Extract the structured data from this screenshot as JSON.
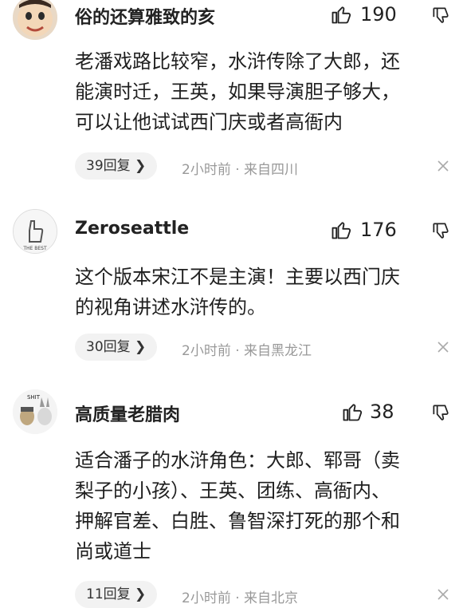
{
  "comments": [
    {
      "username": "俗的还算雅致的亥",
      "likes": "190",
      "lines": [
        "老潘戏路比较窄，水浒传除了大郎，还",
        "能演时迁，王英，如果导演胆子够大，",
        "可以让他试试西门庆或者高衙内"
      ],
      "replies": "39回复",
      "meta": "2小时前 · 来自四川"
    },
    {
      "username": "Zeroseattle",
      "likes": "176",
      "avatar_text": "THE BEST",
      "lines": [
        "这个版本宋江不是主演！主要以西门庆",
        "的视角讲述水浒传的。"
      ],
      "replies": "30回复",
      "meta": "2小时前 · 来自黑龙江"
    },
    {
      "username": "高质量老腊肉",
      "likes": "38",
      "avatar_text": "SHIT",
      "lines": [
        "适合潘子的水浒角色：大郎、郓哥（卖",
        "梨子的小孩）、王英、团练、高衙内、",
        "押解官差、白胜、鲁智深打死的那个和",
        "尚或道士"
      ],
      "replies": "11回复",
      "meta": "2小时前 · 来自北京"
    }
  ],
  "icons": {
    "like": "thumbs-up-icon",
    "dislike": "thumbs-down-icon",
    "reply_arrow": "chevron-right-icon",
    "close": "close-icon"
  }
}
